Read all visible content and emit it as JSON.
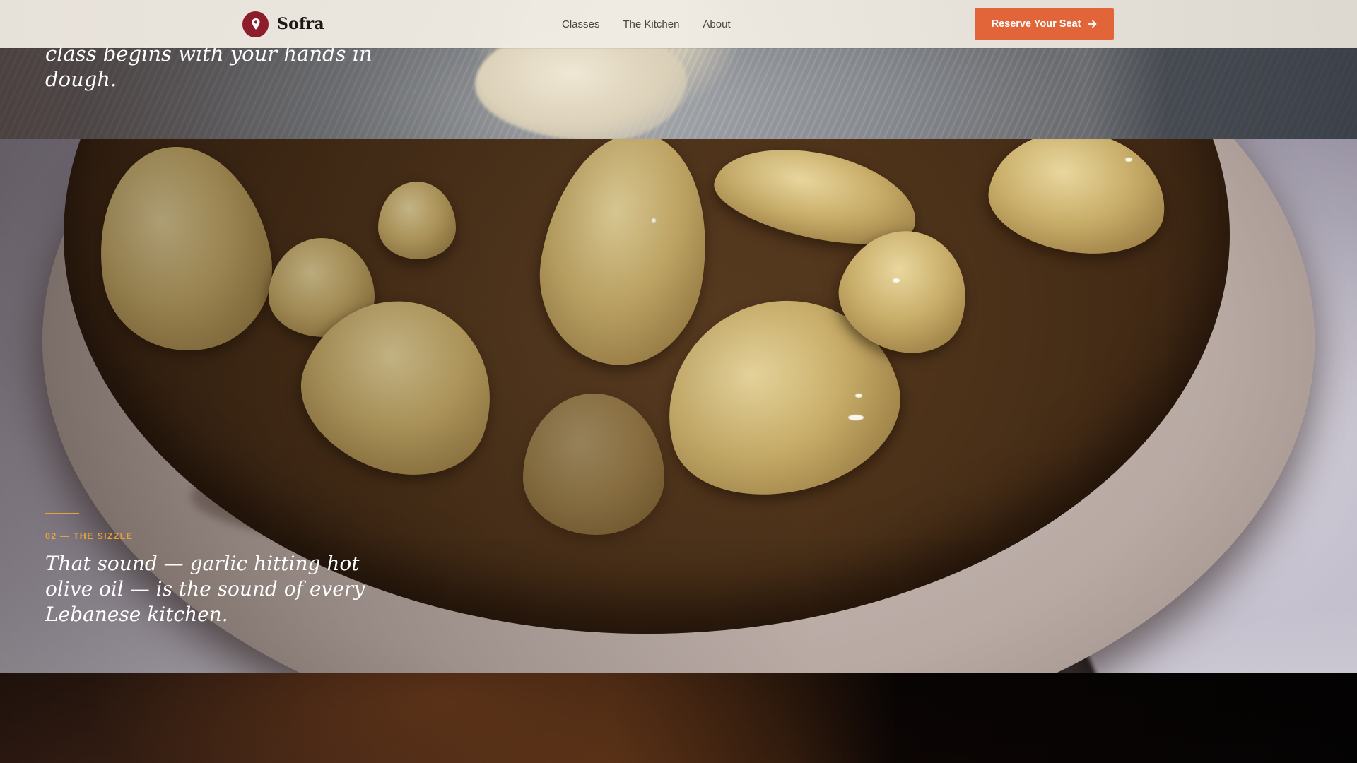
{
  "header": {
    "brand_name": "Sofra",
    "nav": [
      {
        "label": "Classes"
      },
      {
        "label": "The Kitchen"
      },
      {
        "label": "About"
      }
    ],
    "cta_label": "Reserve Your Seat"
  },
  "sections": {
    "dough": {
      "caption": "class begins with your hands in dough."
    },
    "sizzle": {
      "eyebrow": "02 — THE SIZZLE",
      "caption": "That sound — garlic hitting hot olive oil — is the sound of every Lebanese kitchen."
    }
  },
  "colors": {
    "brand_mark": "#8e1d2c",
    "cta": "#e2653a",
    "accent": "#e8a23a"
  },
  "icons": {
    "brand": "map-pin-icon",
    "cta": "arrow-right-icon"
  }
}
